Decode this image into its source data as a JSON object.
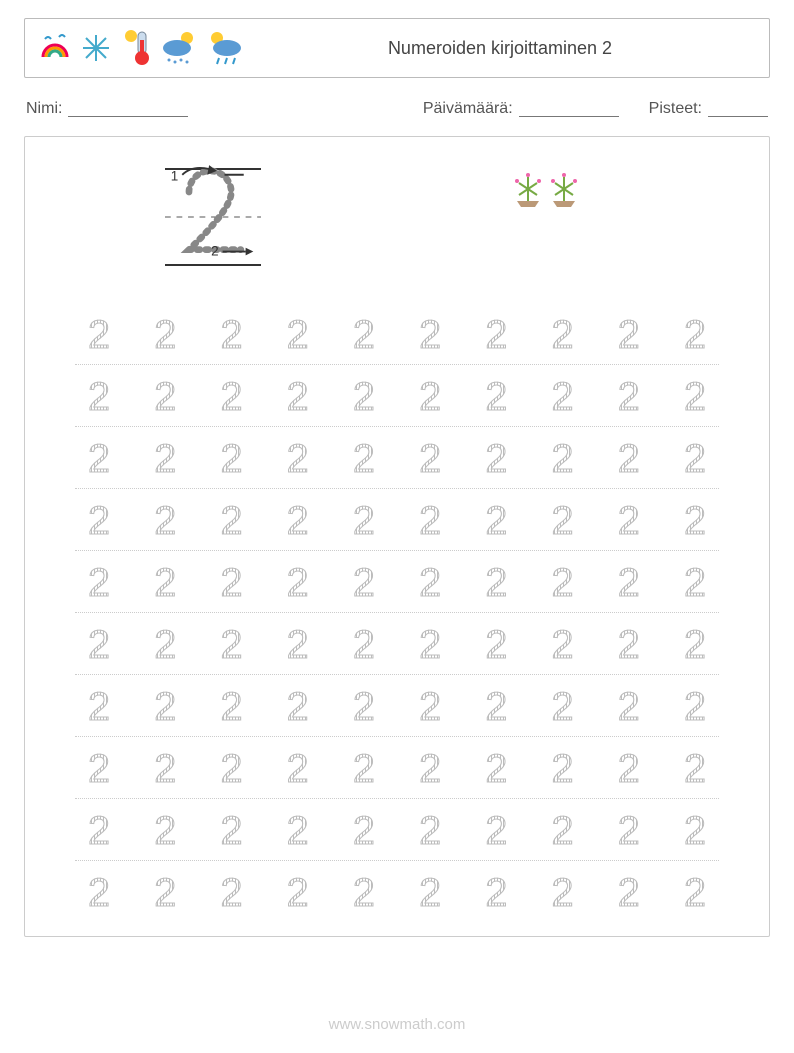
{
  "header": {
    "title": "Numeroiden kirjoittaminen 2"
  },
  "info": {
    "name_label": "Nimi:",
    "date_label": "Päivämäärä:",
    "score_label": "Pisteet:"
  },
  "guide": {
    "stroke1_label": "1",
    "stroke2_label": "2"
  },
  "count_icons": 2,
  "digit": "2",
  "grid_rows": 10,
  "grid_cols": 10,
  "footer": "www.snowmath.com"
}
